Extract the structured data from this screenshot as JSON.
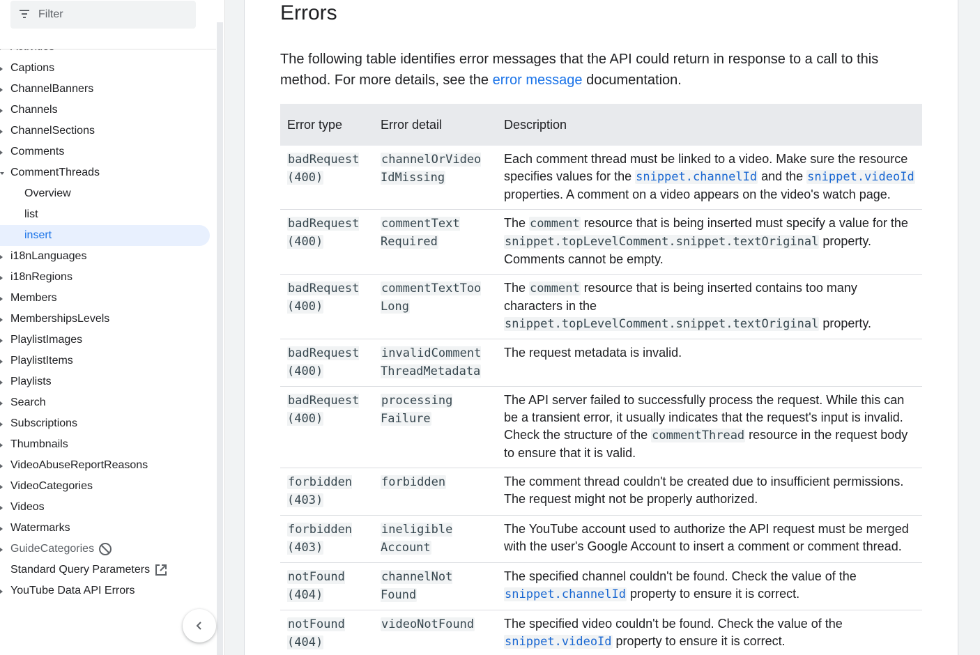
{
  "sidebar": {
    "filter_placeholder": "Filter",
    "items": [
      {
        "label": "Activities",
        "type": "collapsed"
      },
      {
        "label": "Captions",
        "type": "collapsed"
      },
      {
        "label": "ChannelBanners",
        "type": "collapsed"
      },
      {
        "label": "Channels",
        "type": "collapsed"
      },
      {
        "label": "ChannelSections",
        "type": "collapsed"
      },
      {
        "label": "Comments",
        "type": "collapsed"
      },
      {
        "label": "CommentThreads",
        "type": "expanded"
      },
      {
        "label": "Overview",
        "type": "child"
      },
      {
        "label": "list",
        "type": "child"
      },
      {
        "label": "insert",
        "type": "child-active"
      },
      {
        "label": "i18nLanguages",
        "type": "collapsed"
      },
      {
        "label": "i18nRegions",
        "type": "collapsed"
      },
      {
        "label": "Members",
        "type": "collapsed"
      },
      {
        "label": "MembershipsLevels",
        "type": "collapsed"
      },
      {
        "label": "PlaylistImages",
        "type": "collapsed"
      },
      {
        "label": "PlaylistItems",
        "type": "collapsed"
      },
      {
        "label": "Playlists",
        "type": "collapsed"
      },
      {
        "label": "Search",
        "type": "collapsed"
      },
      {
        "label": "Subscriptions",
        "type": "collapsed"
      },
      {
        "label": "Thumbnails",
        "type": "collapsed"
      },
      {
        "label": "VideoAbuseReportReasons",
        "type": "collapsed"
      },
      {
        "label": "VideoCategories",
        "type": "collapsed"
      },
      {
        "label": "Videos",
        "type": "collapsed"
      },
      {
        "label": "Watermarks",
        "type": "collapsed"
      },
      {
        "label": "GuideCategories",
        "type": "collapsed-deprecated",
        "icon": "deprecated-icon"
      },
      {
        "label": "Standard Query Parameters",
        "type": "external",
        "icon": "external-link-icon"
      },
      {
        "label": "YouTube Data API Errors",
        "type": "collapsed"
      }
    ],
    "collapse_icon": "chevron-left-icon"
  },
  "main": {
    "title": "Errors",
    "intro_text_before": "The following table identifies error messages that the API could return in response to a call to this method. For more details, see the ",
    "intro_link": "error message",
    "intro_text_after": " documentation.",
    "table": {
      "headers": [
        "Error type",
        "Error detail",
        "Description"
      ],
      "rows": [
        {
          "type_a": "badRequest",
          "type_b": "(400)",
          "detail_a": "channelOrVideo",
          "detail_b": "IdMissing",
          "desc": [
            {
              "t": "text",
              "v": "Each comment thread must be linked to a video. Make sure the resource specifies values for the "
            },
            {
              "t": "linkcode",
              "v": "snippet.channelId"
            },
            {
              "t": "text",
              "v": " and the "
            },
            {
              "t": "linkcode",
              "v": "snippet.videoId"
            },
            {
              "t": "text",
              "v": " properties. A comment on a video appears on the video's watch page."
            }
          ]
        },
        {
          "type_a": "badRequest",
          "type_b": "(400)",
          "detail_a": "commentText",
          "detail_b": "Required",
          "desc": [
            {
              "t": "text",
              "v": "The "
            },
            {
              "t": "code",
              "v": "comment"
            },
            {
              "t": "text",
              "v": " resource that is being inserted must specify a value for the "
            },
            {
              "t": "code",
              "v": "snippet.topLevelComment.snippet.textOriginal"
            },
            {
              "t": "text",
              "v": " property. Comments cannot be empty."
            }
          ]
        },
        {
          "type_a": "badRequest",
          "type_b": "(400)",
          "detail_a": "commentTextToo",
          "detail_b": "Long",
          "desc": [
            {
              "t": "text",
              "v": "The "
            },
            {
              "t": "code",
              "v": "comment"
            },
            {
              "t": "text",
              "v": " resource that is being inserted contains too many characters in the "
            },
            {
              "t": "code",
              "v": "snippet.topLevelComment.snippet.textOriginal"
            },
            {
              "t": "text",
              "v": " property."
            }
          ]
        },
        {
          "type_a": "badRequest",
          "type_b": "(400)",
          "detail_a": "invalidComment",
          "detail_b": "ThreadMetadata",
          "desc": [
            {
              "t": "text",
              "v": "The request metadata is invalid."
            }
          ]
        },
        {
          "type_a": "badRequest",
          "type_b": "(400)",
          "detail_a": "processing",
          "detail_b": "Failure",
          "desc": [
            {
              "t": "text",
              "v": "The API server failed to successfully process the request. While this can be a transient error, it usually indicates that the request's input is invalid. Check the structure of the "
            },
            {
              "t": "code",
              "v": "commentThread"
            },
            {
              "t": "text",
              "v": " resource in the request body to ensure that it is valid."
            }
          ]
        },
        {
          "type_a": "forbidden",
          "type_b": "(403)",
          "detail_a": "forbidden",
          "detail_b": "",
          "desc": [
            {
              "t": "text",
              "v": "The comment thread couldn't be created due to insufficient permissions. The request might not be properly authorized."
            }
          ]
        },
        {
          "type_a": "forbidden",
          "type_b": "(403)",
          "detail_a": "ineligible",
          "detail_b": "Account",
          "desc": [
            {
              "t": "text",
              "v": "The YouTube account used to authorize the API request must be merged with the user's Google Account to insert a comment or comment thread."
            }
          ]
        },
        {
          "type_a": "notFound",
          "type_b": "(404)",
          "detail_a": "channelNot",
          "detail_b": "Found",
          "desc": [
            {
              "t": "text",
              "v": "The specified channel couldn't be found. Check the value of the "
            },
            {
              "t": "linkcode",
              "v": "snippet.channelId"
            },
            {
              "t": "text",
              "v": " property to ensure it is correct."
            }
          ]
        },
        {
          "type_a": "notFound",
          "type_b": "(404)",
          "detail_a": "videoNotFound",
          "detail_b": "",
          "desc": [
            {
              "t": "text",
              "v": "The specified video couldn't be found. Check the value of the "
            },
            {
              "t": "linkcode",
              "v": "snippet.videoId"
            },
            {
              "t": "text",
              "v": " property to ensure it is correct."
            }
          ]
        }
      ]
    }
  },
  "colors": {
    "link": "#1a73e8",
    "code_link": "#1967d2",
    "active_bg": "#e8f0fe",
    "header_bg": "#e8eaed"
  }
}
